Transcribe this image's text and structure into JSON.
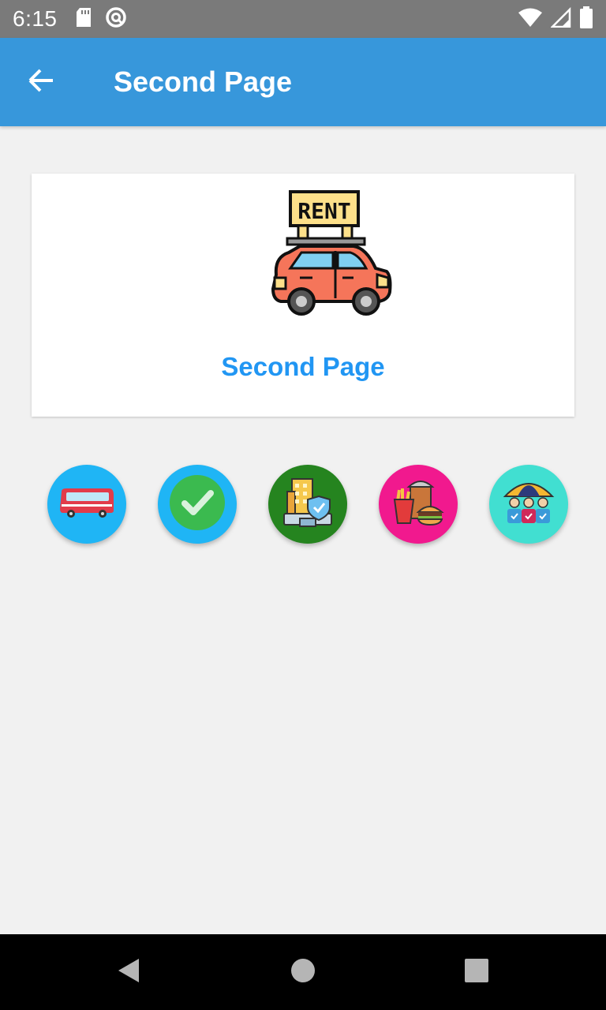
{
  "status_bar": {
    "time": "6:15",
    "icons": [
      "sd-card-icon",
      "do-not-disturb-icon",
      "wifi-icon",
      "signal-icon",
      "battery-icon"
    ]
  },
  "app_bar": {
    "title": "Second Page",
    "back_icon": "arrow-back-icon",
    "color": "#3797db"
  },
  "card": {
    "image_icon": "rent-car-icon",
    "image_sign_text": "RENT",
    "title": "Second Page",
    "title_color": "#2196f3"
  },
  "icon_buttons": [
    {
      "name": "bus-icon",
      "bg": "#1fb5f5"
    },
    {
      "name": "checkmark-icon",
      "bg": "#1fb5f5"
    },
    {
      "name": "building-shield-icon",
      "bg": "#25841f"
    },
    {
      "name": "fast-food-icon",
      "bg": "#f1198e"
    },
    {
      "name": "people-umbrella-icon",
      "bg": "#41dfd1"
    }
  ],
  "nav_bar": {
    "icons": [
      "back-triangle-icon",
      "home-circle-icon",
      "recents-square-icon"
    ]
  }
}
